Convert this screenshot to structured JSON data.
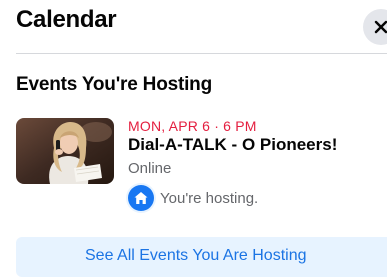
{
  "header": {
    "title": "Calendar",
    "close_icon": "close-icon"
  },
  "section": {
    "title": "Events You're Hosting"
  },
  "event": {
    "date": "MON, APR 6 · 6 PM",
    "name": "Dial-A-TALK - O Pioneers!",
    "location": "Online",
    "hosting_text": "You're hosting.",
    "hosting_icon": "home-icon",
    "date_color": "#e41e3f"
  },
  "footer": {
    "see_all_label": "See All Events You Are Hosting"
  },
  "colors": {
    "accent": "#1877f2",
    "button_bg": "#e7f3ff",
    "secondary_text": "#65676b"
  }
}
